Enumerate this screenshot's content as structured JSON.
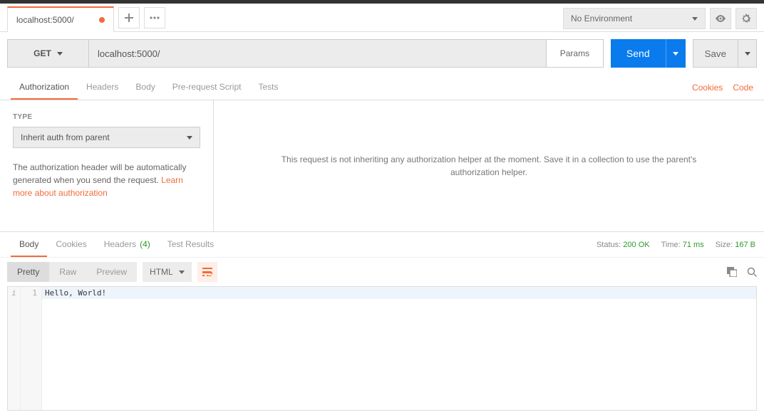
{
  "header": {
    "tab_title": "localhost:5000/",
    "environment_label": "No Environment"
  },
  "request": {
    "method": "GET",
    "url": "localhost:5000/",
    "params_label": "Params",
    "send_label": "Send",
    "save_label": "Save"
  },
  "req_tabs": {
    "authorization": "Authorization",
    "headers": "Headers",
    "body": "Body",
    "prerequest": "Pre-request Script",
    "tests": "Tests"
  },
  "req_links": {
    "cookies": "Cookies",
    "code": "Code"
  },
  "auth": {
    "type_label": "TYPE",
    "type_value": "Inherit auth from parent",
    "desc_pre": "The authorization header will be automatically generated when you send the request. ",
    "desc_link": "Learn more about authorization",
    "right_msg": "This request is not inheriting any authorization helper at the moment. Save it in a collection to use the parent's authorization helper."
  },
  "resp_tabs": {
    "body": "Body",
    "cookies": "Cookies",
    "headers": "Headers",
    "headers_count": "(4)",
    "tests": "Test Results"
  },
  "resp_meta": {
    "status_label": "Status:",
    "status_value": "200 OK",
    "time_label": "Time:",
    "time_value": "71 ms",
    "size_label": "Size:",
    "size_value": "167 B"
  },
  "format": {
    "pretty": "Pretty",
    "raw": "Raw",
    "preview": "Preview",
    "lang": "HTML"
  },
  "response_body": {
    "line_num": "1",
    "line_content": "Hello, World!"
  }
}
